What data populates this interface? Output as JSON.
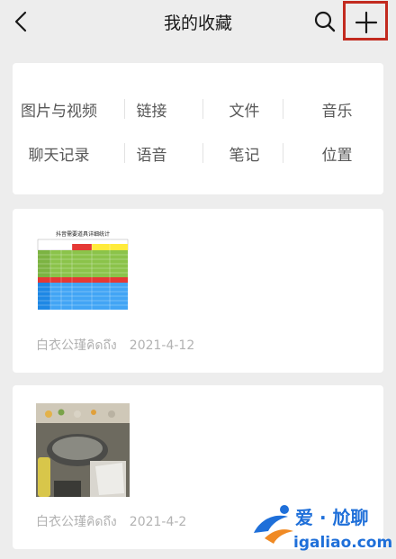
{
  "header": {
    "title": "我的收藏"
  },
  "categories": {
    "row1": [
      "图片与视频",
      "链接",
      "文件",
      "音乐"
    ],
    "row2": [
      "聊天记录",
      "语音",
      "笔记",
      "位置"
    ]
  },
  "items": [
    {
      "source": "白衣公瑾คิดถึง",
      "date": "2021-4-12",
      "thumb_title": "抖音需要道具详细统计"
    },
    {
      "source": "白衣公瑾คิดถึง",
      "date": "2021-4-2"
    }
  ],
  "watermark": {
    "brand": "爱 · 尬聊",
    "domain": "igaliao.com"
  },
  "colors": {
    "accent_border": "#c22a1f",
    "background": "#ededed",
    "meta_text": "#b2b2b2"
  },
  "icons": {
    "back": "chevron-left-icon",
    "search": "search-icon",
    "add": "plus-icon"
  }
}
